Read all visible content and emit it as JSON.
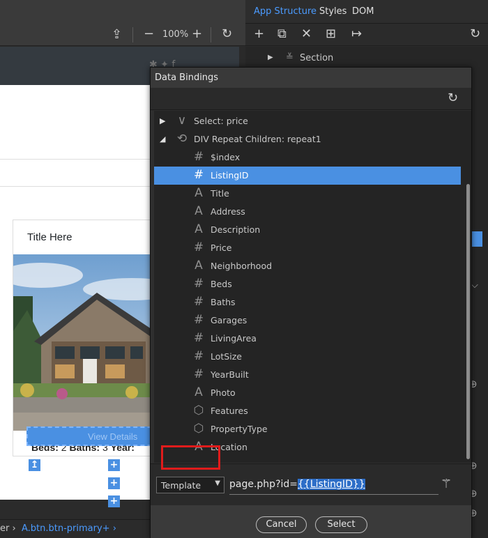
{
  "panel_tabs": [
    "App Structure",
    "Styles",
    "DOM"
  ],
  "toolbar": {
    "zoom": "100%"
  },
  "structure": {
    "section_label": "Section"
  },
  "canvas": {
    "card_title": "Title Here",
    "beds_label": "Beds:",
    "beds_value": "2",
    "baths_label": "Baths:",
    "baths_value": "3",
    "year_label": "Year:",
    "button_label": "View Details"
  },
  "breadcrumb": {
    "prefix": "er ›",
    "current": "A.btn.btn-primary+ ›"
  },
  "dialog": {
    "title": "Data Bindings",
    "tree": [
      {
        "icon": "chevron-icon",
        "label": "Select: price",
        "expand": "collapsed"
      },
      {
        "icon": "repeat-icon",
        "label": "DIV Repeat Children: repeat1",
        "expand": "expanded"
      },
      {
        "icon": "number-icon",
        "label": "$index"
      },
      {
        "icon": "number-icon",
        "label": "ListingID",
        "selected": true
      },
      {
        "icon": "text-icon",
        "label": "Title"
      },
      {
        "icon": "text-icon",
        "label": "Address"
      },
      {
        "icon": "text-icon",
        "label": "Description"
      },
      {
        "icon": "number-icon",
        "label": "Price"
      },
      {
        "icon": "text-icon",
        "label": "Neighborhood"
      },
      {
        "icon": "number-icon",
        "label": "Beds"
      },
      {
        "icon": "number-icon",
        "label": "Baths"
      },
      {
        "icon": "number-icon",
        "label": "Garages"
      },
      {
        "icon": "number-icon",
        "label": "LivingArea"
      },
      {
        "icon": "number-icon",
        "label": "LotSize"
      },
      {
        "icon": "number-icon",
        "label": "YearBuilt"
      },
      {
        "icon": "text-icon",
        "label": "Photo"
      },
      {
        "icon": "object-icon",
        "label": "Features"
      },
      {
        "icon": "object-icon",
        "label": "PropertyType"
      },
      {
        "icon": "text-icon",
        "label": "Location"
      }
    ],
    "format_select": "Template",
    "expression_prefix": "page.php?id=",
    "expression_binding": "{{ListingID}}",
    "cancel_label": "Cancel",
    "select_label": "Select"
  },
  "colors": {
    "accent": "#4a90e2",
    "highlight_outline": "#e01b1b"
  }
}
